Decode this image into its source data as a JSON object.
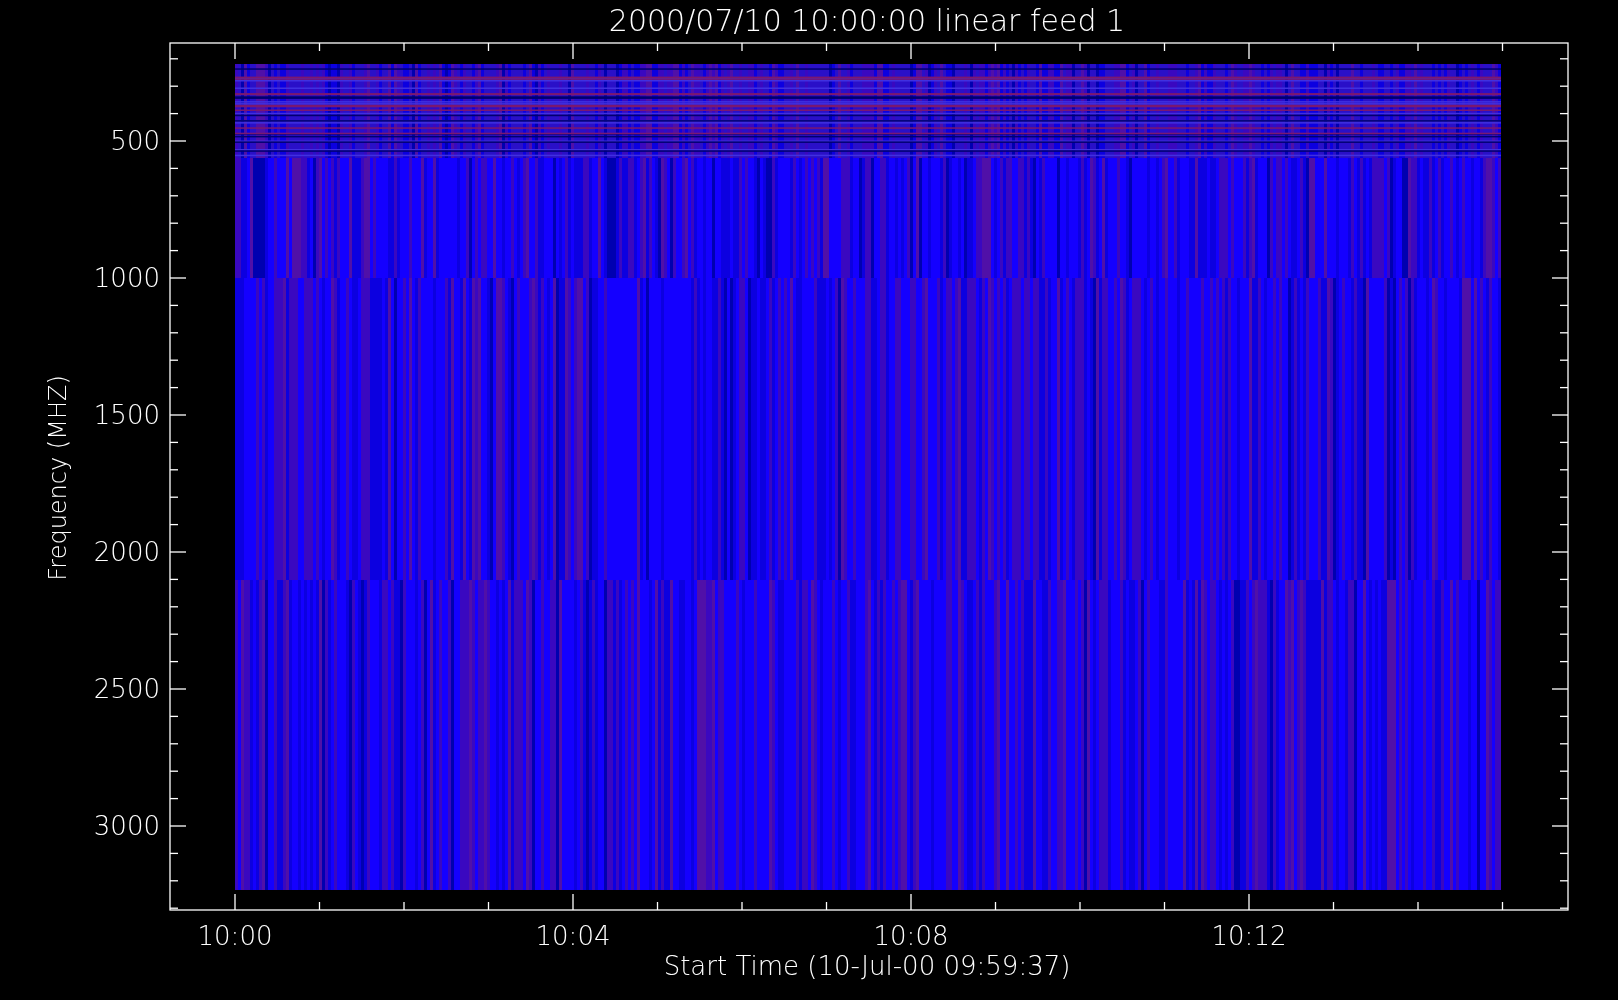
{
  "title": "2000/07/10 10:00:00 linear feed 1",
  "y_axis": {
    "label": "Frequency (MHZ)",
    "ticks": [
      "500",
      "1000",
      "1500",
      "2000",
      "2500",
      "3000"
    ]
  },
  "x_axis": {
    "label": "Start Time (10-Jul-00 09:59:37)",
    "ticks": [
      "10:00",
      "10:04",
      "10:08",
      "10:12"
    ]
  }
}
